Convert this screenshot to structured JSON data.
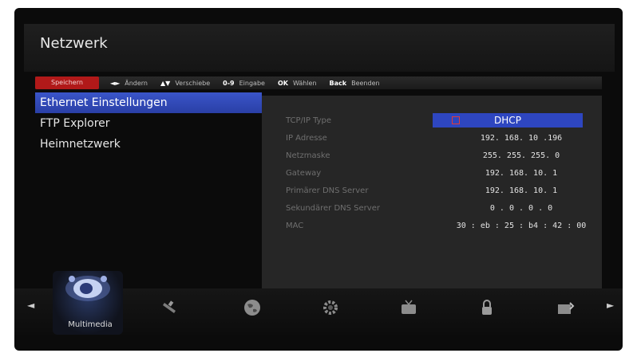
{
  "screen": {
    "title": "Netzwerk"
  },
  "keybar": {
    "save_label": "Speichern",
    "items": [
      {
        "key": "◄►",
        "label": "Ändern"
      },
      {
        "key": "▲▼",
        "label": "Verschiebe"
      },
      {
        "key": "0-9",
        "label": "Eingabe"
      },
      {
        "key": "OK",
        "label": "Wählen"
      },
      {
        "key": "Back",
        "label": "Beenden"
      }
    ]
  },
  "menu": {
    "items": [
      {
        "label": "Ethernet Einstellungen",
        "active": true
      },
      {
        "label": "FTP Explorer",
        "active": false
      },
      {
        "label": "Heimnetzwerk",
        "active": false
      }
    ]
  },
  "settings": {
    "tcpip_type": {
      "label": "TCP/IP Type",
      "value": "DHCP"
    },
    "ip": {
      "label": "IP Adresse",
      "value": "192. 168. 10 .196"
    },
    "netmask": {
      "label": "Netzmaske",
      "value": "255. 255. 255.  0"
    },
    "gateway": {
      "label": "Gateway",
      "value": "192. 168. 10.  1"
    },
    "dns1": {
      "label": "Primärer DNS Server",
      "value": "192. 168. 10.  1"
    },
    "dns2": {
      "label": "Sekundärer DNS Server",
      "value": "0 .  0 .  0 .  0"
    },
    "mac": {
      "label": "MAC",
      "value": "30 : eb : 25 : b4 : 42 : 00"
    }
  },
  "bottom_bar": {
    "selected_label": "Multimedia",
    "icons": [
      "multimedia-icon",
      "satellite-dish-icon",
      "globe-icon",
      "gear-icon",
      "tv-icon",
      "lock-icon",
      "tools-icon"
    ]
  },
  "colors": {
    "highlight": "#2e46c0",
    "save": "#b11919",
    "panel": "#262626"
  }
}
